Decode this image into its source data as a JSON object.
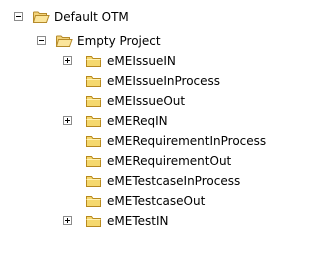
{
  "tree": {
    "root": {
      "label": "Default OTM",
      "expanded": true,
      "icon": "folder-open-icon"
    },
    "project": {
      "label": "Empty Project",
      "expanded": true,
      "icon": "folder-open-icon"
    },
    "items": [
      {
        "label": "eMEIssueIN",
        "expandable": true
      },
      {
        "label": "eMEIssueInProcess",
        "expandable": false
      },
      {
        "label": "eMEIssueOut",
        "expandable": false
      },
      {
        "label": "eMEReqIN",
        "expandable": true
      },
      {
        "label": "eMERequirementInProcess",
        "expandable": false
      },
      {
        "label": "eMERequirementOut",
        "expandable": false
      },
      {
        "label": "eMETestcaseInProcess",
        "expandable": false
      },
      {
        "label": "eMETestcaseOut",
        "expandable": false
      },
      {
        "label": "eMETestIN",
        "expandable": true
      }
    ],
    "colors": {
      "folder_fill": "#f5d86e",
      "folder_stroke": "#b8891e",
      "expander_border": "#8c8c8c"
    }
  }
}
